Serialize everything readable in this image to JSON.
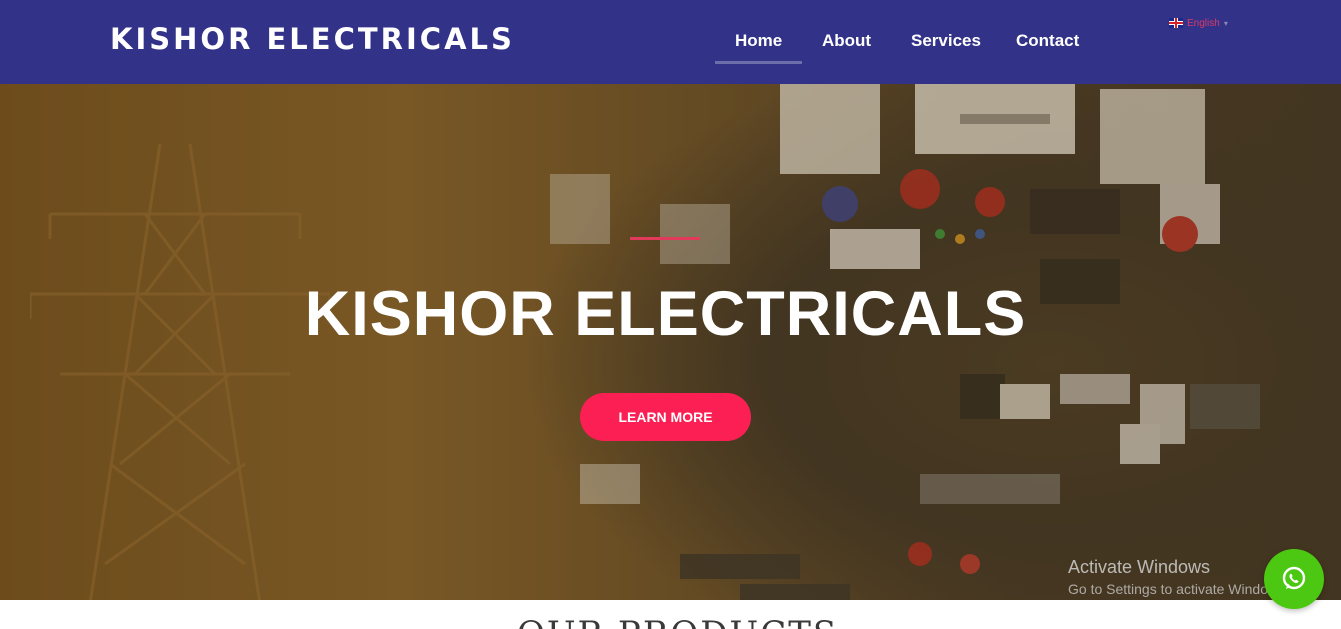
{
  "header": {
    "logo": "KISHOR ELECTRICALS",
    "nav": [
      {
        "label": "Home",
        "active": true
      },
      {
        "label": "About"
      },
      {
        "label": "Services"
      },
      {
        "label": "Contact"
      }
    ],
    "language": "English",
    "language_caret": "▾"
  },
  "hero": {
    "title": "KISHOR ELECTRICALS",
    "button_label": "LEARN MORE"
  },
  "watermark": {
    "title": "Activate Windows",
    "subtitle": "Go to Settings to activate Windows."
  },
  "section": {
    "title": "OUR PRODUCTS"
  },
  "colors": {
    "header_bg": "#333289",
    "button_bg": "#fc1f54",
    "whatsapp_bg": "#4cc712",
    "accent_line": "#e23a5a"
  },
  "icons": {
    "whatsapp": "whatsapp-icon",
    "language_flag": "uk-flag-icon"
  }
}
